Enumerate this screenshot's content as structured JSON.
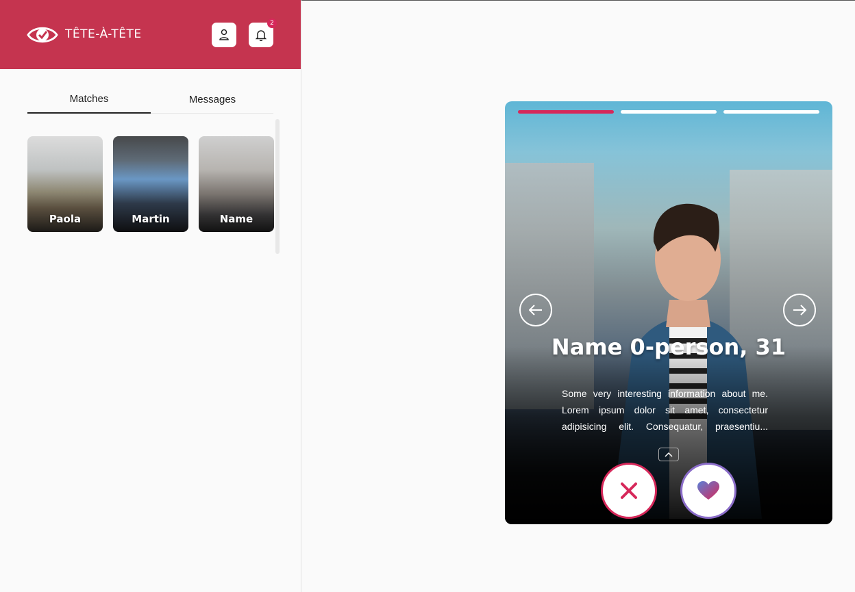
{
  "app": {
    "brand": "TÊTE-À-TÊTE"
  },
  "header": {
    "notification_count": "2"
  },
  "tabs": [
    {
      "label": "Matches"
    },
    {
      "label": "Messages"
    }
  ],
  "matches": [
    {
      "name": "Paola"
    },
    {
      "name": "Martin"
    },
    {
      "name": "Name"
    }
  ],
  "card": {
    "title": "Name 0-person, 31",
    "bio": "Some very interesting information about me. Lorem ipsum dolor sit amet, consectetur adipisicing elit. Consequatur, praesentiu...",
    "photo_count": 3,
    "active_photo": 1
  },
  "colors": {
    "brand": "#c5344f",
    "accent": "#d6285a",
    "like": "#8a6cc8"
  }
}
